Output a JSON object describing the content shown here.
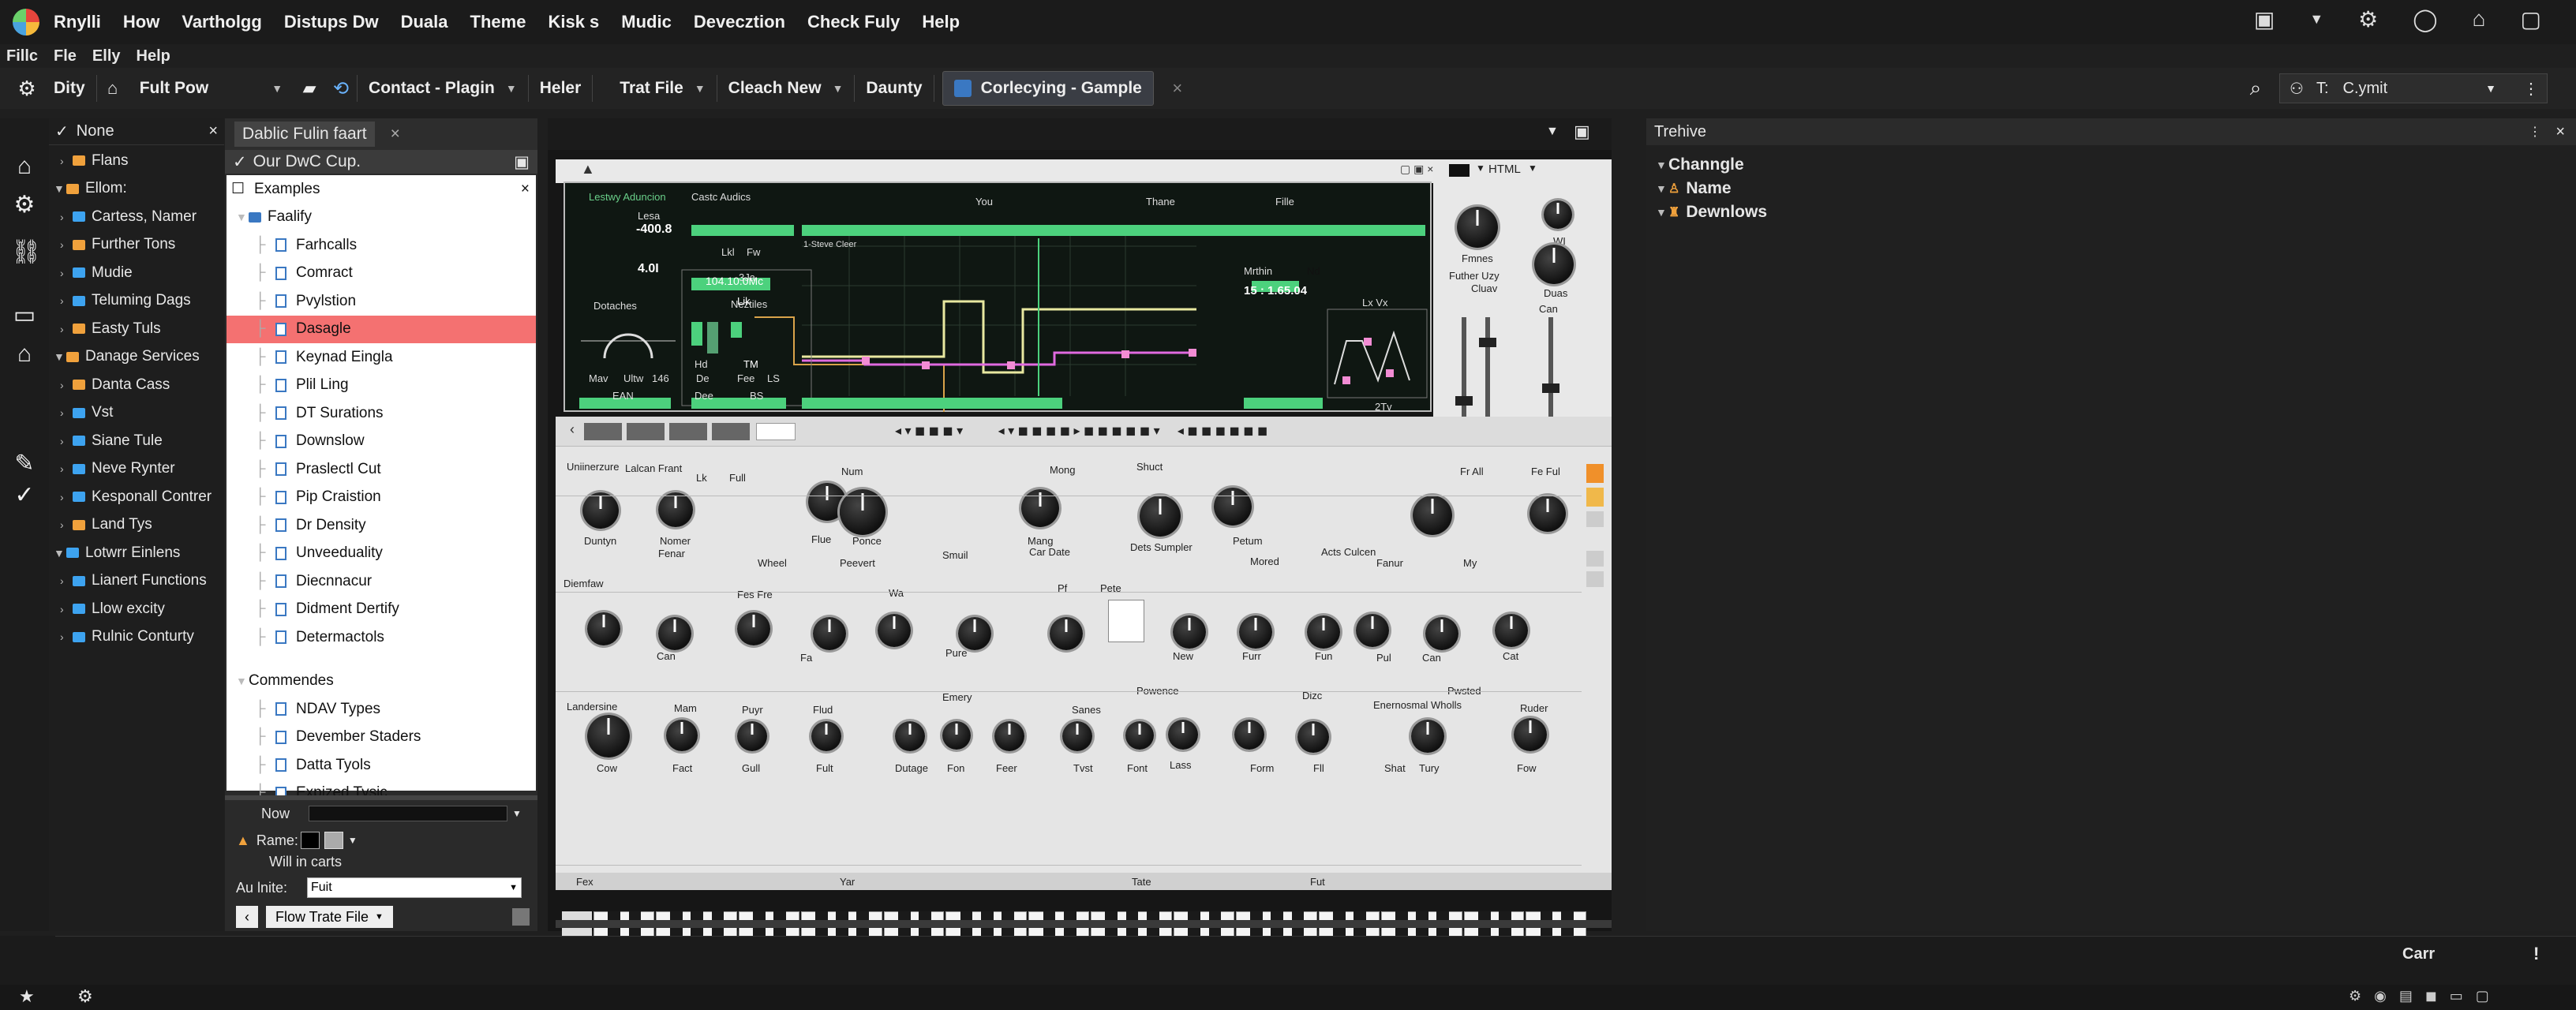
{
  "menubar": {
    "items": [
      "Rnylli",
      "How",
      "Vartholgg",
      "Distups Dw",
      "Duala",
      "Theme",
      "Kisk s",
      "Mudic",
      "Devecztion",
      "Check Fuly",
      "Help"
    ]
  },
  "menu2": {
    "items": [
      "Fillc",
      "Fle",
      "Elly",
      "Help"
    ]
  },
  "toolbar": {
    "items": [
      "Dity",
      "Fult Pow",
      "Contact - Plagin",
      "Heler",
      "Trat File",
      "Cleach New",
      "Daunty",
      "Corlecying - Gample"
    ],
    "search_value": "C.ymit",
    "search_prefix": "T:"
  },
  "sidebar": {
    "header": "None",
    "items": [
      {
        "label": "Flans",
        "color": "#f0a13c",
        "level": 1
      },
      {
        "label": "Ellom:",
        "color": "#f0a13c",
        "level": 0
      },
      {
        "label": "Cartess, Namer",
        "color": "#3da3f0",
        "level": 1
      },
      {
        "label": "Further Tons",
        "color": "#f0a13c",
        "level": 1
      },
      {
        "label": "Mudie",
        "color": "#3da3f0",
        "level": 1
      },
      {
        "label": "Teluming Dags",
        "color": "#3da3f0",
        "level": 1
      },
      {
        "label": "Easty Tuls",
        "color": "#f0a13c",
        "level": 1
      },
      {
        "label": "Danage Services",
        "color": "#f0a13c",
        "level": 0
      },
      {
        "label": "Danta Cass",
        "color": "#f0a13c",
        "level": 1
      },
      {
        "label": "Vst",
        "color": "#3da3f0",
        "level": 1
      },
      {
        "label": "Siane Tule",
        "color": "#3da3f0",
        "level": 1
      },
      {
        "label": "Neve Rynter",
        "color": "#3da3f0",
        "level": 1
      },
      {
        "label": "Kesponall Contrer",
        "color": "#3da3f0",
        "level": 1
      },
      {
        "label": "Land Tys",
        "color": "#f0a13c",
        "level": 1
      },
      {
        "label": "Lotwrr Einlens",
        "color": "#3da3f0",
        "level": 0
      },
      {
        "label": "Lianert Functions",
        "color": "#3da3f0",
        "level": 1
      },
      {
        "label": "Llow excity",
        "color": "#3da3f0",
        "level": 1
      },
      {
        "label": "Rulnic Conturty",
        "color": "#3da3f0",
        "level": 1
      }
    ]
  },
  "explorer": {
    "tab": "Dablic Fulin faart",
    "title": "Our DwC Cup.",
    "root": "Examples",
    "group1": "Faalify",
    "files1": [
      "Farhcalls",
      "Comract",
      "Pvylstion",
      "Dasagle",
      "Keynad Eingla",
      "Plil Ling",
      "DT Surations",
      "Downslow",
      "Praslectl Cut",
      "Pip Craistion",
      "Dr Density",
      "Unveeduality",
      "Diecnnacur",
      "Didment Dertify",
      "Determactols"
    ],
    "selected": "Dasagle",
    "group2": "Commendes",
    "files2": [
      "NDAV Types",
      "Devember Staders",
      "Datta Tyols",
      "Expized Tysic"
    ],
    "bottom": {
      "now_label": "Now",
      "rame_label": "Rame:",
      "will_text": "Will in carts",
      "au_label": "Au lnite:",
      "au_value": "Fuit",
      "flow_button": "Flow Trate File"
    }
  },
  "synth": {
    "screen": {
      "left_header": "Lestwy Aduncion",
      "left_value_label": "Lesa",
      "left_value": "-400.8",
      "left_value2": "4.0I",
      "lfo_header": "Castc Audics",
      "lfo_labels": [
        "Lkl",
        "Fw"
      ],
      "lfo_value": "3Ja",
      "section2": "Dotaches",
      "section2b": "Neztiles",
      "knob_labels": [
        "Mav",
        "Ultw",
        "146"
      ],
      "ean": "EAN",
      "hd": "Hd",
      "fee": "Fee",
      "ls": "LS",
      "de": "De",
      "dee": "Dee",
      "bs": "BS",
      "seg1": "You",
      "seg2": "Thane",
      "seg3": "Fille",
      "graph_title": "104.10.0Mc",
      "graph_label": "Lik",
      "tm": "TM",
      "freq_box": "1-Steve Cleer",
      "readout_label": "Mrthin",
      "readout_sub": "Nd",
      "readout_value": "15 : 1.65.04",
      "env_title": "Lx Vx",
      "footer_val": "2Tv"
    },
    "right": {
      "html_label": "HTML",
      "knob1": "Fmnes",
      "knob2": "WI",
      "knob3": "Duas",
      "fader1": "Futher Uzy",
      "fader2": "Cluav",
      "fader3": "Can"
    },
    "row1": [
      "Uniinerzure",
      "Lalcan Frant",
      "Lk",
      "Full",
      "Num",
      "Mong",
      "Shuct",
      "Fr All",
      "Fe Ful"
    ],
    "row1b": [
      "Duntyn",
      "Nomer",
      "Flue",
      "Ponce",
      "Mang",
      "Dets Sumpler",
      "Petum",
      "Acts Culcen"
    ],
    "row1c": [
      "Fenar",
      "Wheel",
      "Peevert",
      "Smuil",
      "Car Date",
      "Mored",
      "Fanur",
      "My"
    ],
    "row2": [
      "Diemfaw",
      "Can",
      "Fes Fre",
      "Fa",
      "Wa",
      "Pure",
      "Pf",
      "Pete",
      "New",
      "Furr",
      "Fun",
      "Pul",
      "Can",
      "Cat"
    ],
    "row3": [
      "Landersine",
      "Mam",
      "Puyr",
      "Flud",
      "Emery",
      "Sanes",
      "Powence",
      "Dizc",
      "Enernosmal Wholls",
      "Pwsted",
      "Ruder"
    ],
    "row3b": [
      "Cow",
      "Fact",
      "Gull",
      "Fult",
      "Dutage",
      "Fon",
      "Feer",
      "Tvst",
      "Font",
      "Lass",
      "Form",
      "Fll",
      "Shat",
      "Tury",
      "Fow"
    ],
    "bottom_labels": [
      "Fex",
      "Yar",
      "Tate",
      "Fut"
    ]
  },
  "rightpanel": {
    "header": "Trehive",
    "items": [
      "Channgle",
      "Name",
      "Dewnlows"
    ]
  },
  "status": {
    "text": "Carr",
    "excl": "!"
  }
}
